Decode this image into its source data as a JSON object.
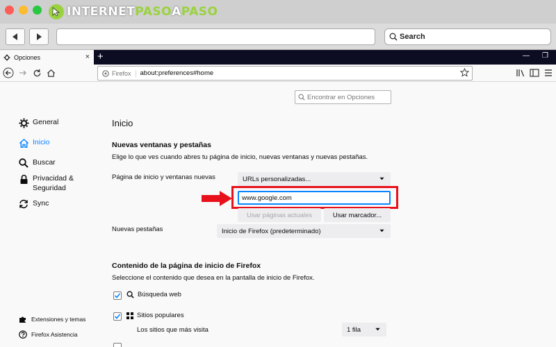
{
  "brand": {
    "part1": "INTERNET",
    "part2": "PASO",
    "part3": "A",
    "part4": "PASO"
  },
  "mac_toolbar": {
    "search_label": "Search"
  },
  "tab": {
    "title": "Opciones",
    "close": "×"
  },
  "newtab_symbol": "+",
  "window_controls": {
    "minimize": "—",
    "restore": "❐"
  },
  "urlbar": {
    "identity_label": "Firefox",
    "url": "about:preferences#home"
  },
  "find": {
    "placeholder": "Encontrar en Opciones"
  },
  "categories": [
    {
      "label": "General",
      "icon": "gear-icon"
    },
    {
      "label": "Inicio",
      "icon": "home-icon"
    },
    {
      "label": "Buscar",
      "icon": "search-icon"
    },
    {
      "label": "Privacidad &",
      "label2": "Seguridad",
      "icon": "lock-icon"
    },
    {
      "label": "Sync",
      "icon": "sync-icon"
    }
  ],
  "main": {
    "heading": "Inicio",
    "section1": {
      "title": "Nuevas ventanas y pestañas",
      "description": "Elige lo que ves cuando abres tu página de inicio, nuevas ventanas y nuevas pestañas.",
      "homepage_label": "Página de inicio y ventanas nuevas",
      "homepage_select": "URLs personalizadas...",
      "homepage_url": "www.google.com",
      "use_current_button": "Usar páginas actuales",
      "use_bookmark_button": "Usar marcador...",
      "newtabs_label": "Nuevas pestañas",
      "newtabs_select": "Inicio de Firefox (predeterminado)"
    },
    "section2": {
      "title": "Contenido de la página de inicio de Firefox",
      "description": "Seleccione el contenido que desea en la pantalla de inicio de Firefox.",
      "web_search": "Búsqueda web",
      "top_sites": "Sitios populares",
      "top_sites_desc": "Los sitios que más visita",
      "rows_select": "1 fila"
    }
  },
  "footer": {
    "extensions": "Extensiones y temas",
    "support": "Firefox Asistencia"
  },
  "colors": {
    "accent": "#0a84ff",
    "highlight": "#e8101b",
    "brand_green": "#9ad23f"
  }
}
